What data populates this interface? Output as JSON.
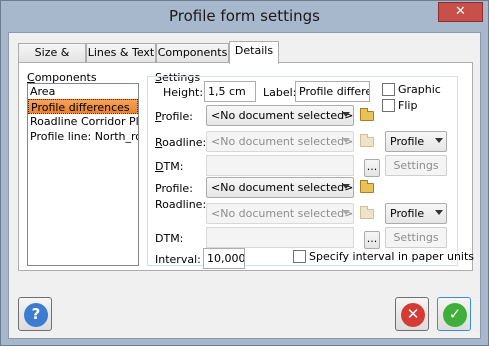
{
  "window": {
    "title": "Profile form settings",
    "close_glyph": "✕"
  },
  "tabs": [
    {
      "label": "Size & Scale"
    },
    {
      "label": "Lines & Text"
    },
    {
      "label": "Components"
    },
    {
      "label": "Details"
    }
  ],
  "components": {
    "label": "Components",
    "items": [
      "Area",
      "Profile differences",
      "Roadline Corridor Pla",
      "Profile line: North_ro"
    ],
    "selected_index": 1
  },
  "settings": {
    "label": "Settings",
    "height_label": "Height:",
    "height_value": "1,5 cm",
    "label_label": "Label:",
    "label_value": "Profile differen",
    "graphic_label": "Graphic",
    "flip_label": "Flip",
    "group1": {
      "profile_label": "Profile:",
      "profile_value": "<No document selected>",
      "roadline_label": "Roadline:",
      "roadline_value": "<No document selected>",
      "roadline_type": "Profile",
      "dtm_label": "DTM:",
      "browse_label": "...",
      "settings_button": "Settings"
    },
    "group2": {
      "profile_label": "Profile:",
      "profile_value": "<No document selected>",
      "roadline_label": "Roadline:",
      "roadline_value": "<No document selected>",
      "roadline_type": "Profile",
      "dtm_label": "DTM:",
      "browse_label": "...",
      "settings_button": "Settings"
    },
    "interval_label": "Interval:",
    "interval_value": "10,000",
    "paper_units_label": "Specify interval in paper units"
  },
  "footer": {
    "help_glyph": "?",
    "cancel_glyph": "✕",
    "ok_glyph": "✓"
  },
  "colors": {
    "title_bar": "#a8b8cc",
    "selection": "#f0963e",
    "help": "#3d7bd0",
    "cancel": "#d43b35",
    "ok": "#3fae3a"
  }
}
